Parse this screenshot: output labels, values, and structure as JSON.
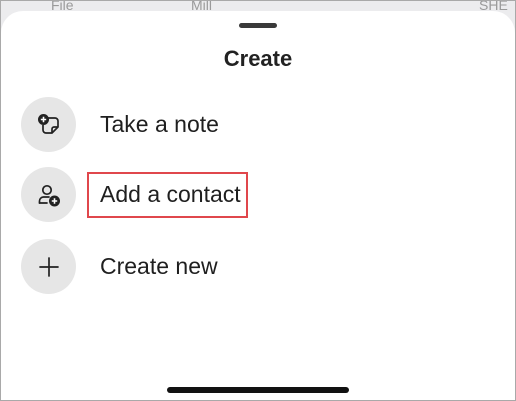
{
  "background_tabs": [
    "File",
    "Mill",
    "SHE"
  ],
  "sheet": {
    "title": "Create",
    "items": [
      {
        "label": "Take a note",
        "icon": "note-plus-icon"
      },
      {
        "label": "Add a contact",
        "icon": "add-contact-icon",
        "highlighted": true
      },
      {
        "label": "Create new",
        "icon": "plus-icon"
      }
    ]
  },
  "colors": {
    "highlight": "#e0474c",
    "icon_bg": "#e6e6e6"
  }
}
